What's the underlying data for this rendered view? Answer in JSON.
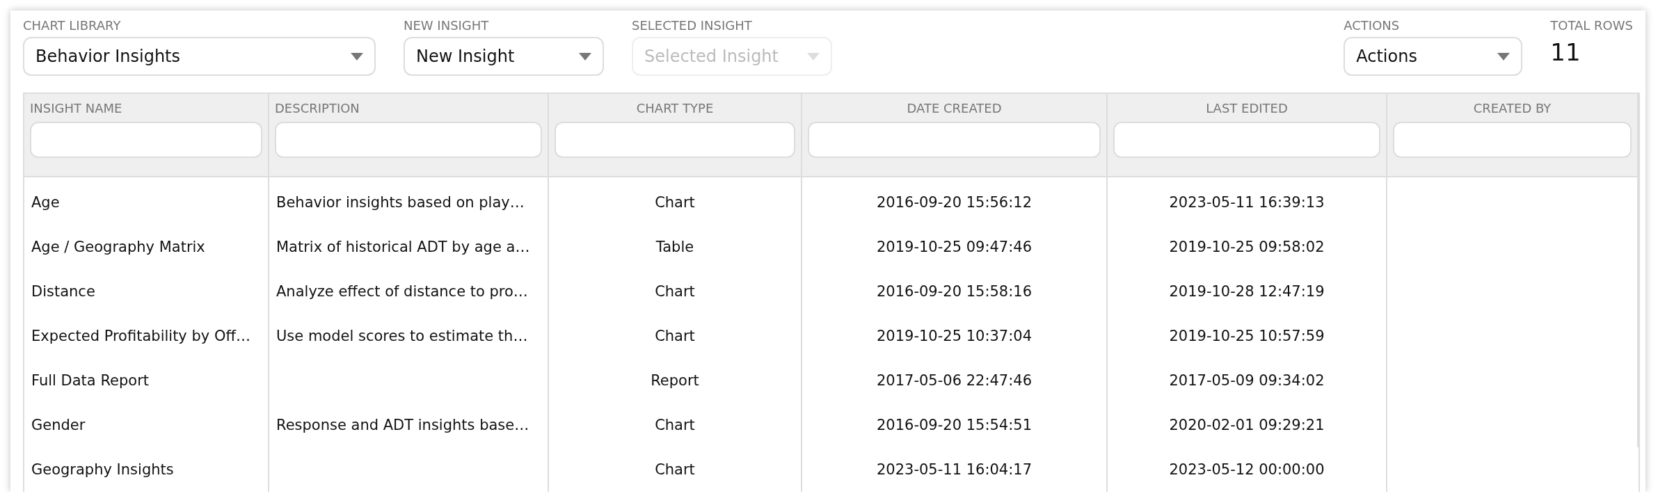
{
  "toolbar": {
    "fields": [
      {
        "label": "CHART LIBRARY",
        "value": "Behavior Insights",
        "disabled": false
      },
      {
        "label": "NEW INSIGHT",
        "value": "New Insight",
        "disabled": false
      },
      {
        "label": "SELECTED INSIGHT",
        "placeholder": "Selected Insight",
        "disabled": true
      }
    ],
    "actions": {
      "label": "ACTIONS",
      "value": "Actions",
      "disabled": false
    },
    "total_rows": {
      "label": "TOTAL ROWS",
      "value": "11"
    }
  },
  "table": {
    "columns": [
      "INSIGHT NAME",
      "DESCRIPTION",
      "CHART TYPE",
      "DATE CREATED",
      "LAST EDITED",
      "CREATED BY"
    ],
    "rows": [
      {
        "name": "Age",
        "description": "Behavior insights based on play…",
        "chart_type": "Chart",
        "date_created": "2016-09-20 15:56:12",
        "last_edited": "2023-05-11 16:39:13"
      },
      {
        "name": "Age / Geography Matrix",
        "description": "Matrix of historical ADT by age a…",
        "chart_type": "Table",
        "date_created": "2019-10-25 09:47:46",
        "last_edited": "2019-10-25 09:58:02"
      },
      {
        "name": "Distance",
        "description": "Analyze effect of distance to pro…",
        "chart_type": "Chart",
        "date_created": "2016-09-20 15:58:16",
        "last_edited": "2019-10-28 12:47:19"
      },
      {
        "name": "Expected Profitability by Off…",
        "description": "Use model scores to estimate th…",
        "chart_type": "Chart",
        "date_created": "2019-10-25 10:37:04",
        "last_edited": "2019-10-25 10:57:59"
      },
      {
        "name": "Full Data Report",
        "chart_type": "Report",
        "date_created": "2017-05-06 22:47:46",
        "last_edited": "2017-05-09 09:34:02"
      },
      {
        "name": "Gender",
        "description": "Response and ADT insights base…",
        "chart_type": "Chart",
        "date_created": "2016-09-20 15:54:51",
        "last_edited": "2020-02-01 09:29:21"
      },
      {
        "name": "Geography Insights",
        "chart_type": "Chart",
        "date_created": "2023-05-11 16:04:17",
        "last_edited": "2023-05-12 00:00:00"
      }
    ]
  }
}
